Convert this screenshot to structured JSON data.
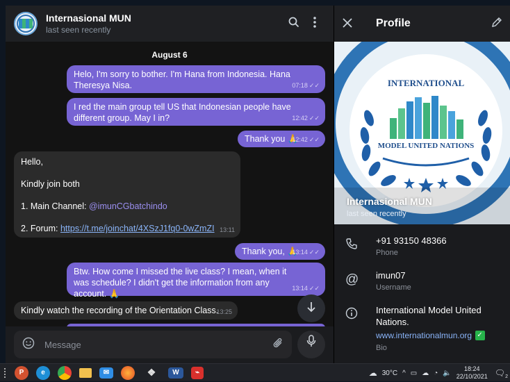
{
  "chat": {
    "title": "Internasional MUN",
    "status": "last seen recently",
    "date": "August 6",
    "messages": [
      {
        "dir": "out",
        "text": "Helo, I'm sorry to bother. I'm Hana from Indonesia. Hana Theresya Nisa.",
        "time": "07:18"
      },
      {
        "dir": "out",
        "text": "I red the main group tell US that Indonesian people have different group. May I in?",
        "time": "12:42"
      },
      {
        "dir": "out",
        "text": "Thank you 🙏",
        "time": "12:42"
      },
      {
        "dir": "in",
        "greeting": "Hello,",
        "line2": "Kindly join both",
        "line3_label": "1. Main Channel: ",
        "line3_mention": "@imunCGbatchindo",
        "line4_label": "2. Forum: ",
        "line4_link": "https://t.me/joinchat/4XSzJ1fq0-0wZmZI",
        "time": "13:11"
      },
      {
        "dir": "out",
        "text": "Thank you, 🙏",
        "time": "13:14"
      },
      {
        "dir": "out",
        "text": "Btw. How come I missed the live class? I mean, when it was schedule? I didn't get the information from any account. 🙏",
        "time": "13:14"
      },
      {
        "dir": "in",
        "text": "Kindly watch the recording of the Orientation Class.",
        "time": "13:25"
      }
    ],
    "composer_placeholder": "Message"
  },
  "profile": {
    "header_title": "Profile",
    "name": "Internasional MUN",
    "status": "last seen recently",
    "banner_text_top": "INTERNATIONAL",
    "banner_text_mid": "MODEL UNITED NATIONS",
    "phone": "+91 93150 48366",
    "phone_label": "Phone",
    "username": "imun07",
    "username_label": "Username",
    "bio": "International Model United Nations.",
    "bio_link": "www.internationalmun.org",
    "bio_label": "Bio"
  },
  "taskbar": {
    "temperature": "30°C",
    "time": "18:24",
    "date": "22/10/2021",
    "notification_count": "2"
  },
  "colors": {
    "outgoing_bubble": "#7764d4",
    "incoming_bubble": "#2b2b2b",
    "link": "#8ab4f8"
  }
}
